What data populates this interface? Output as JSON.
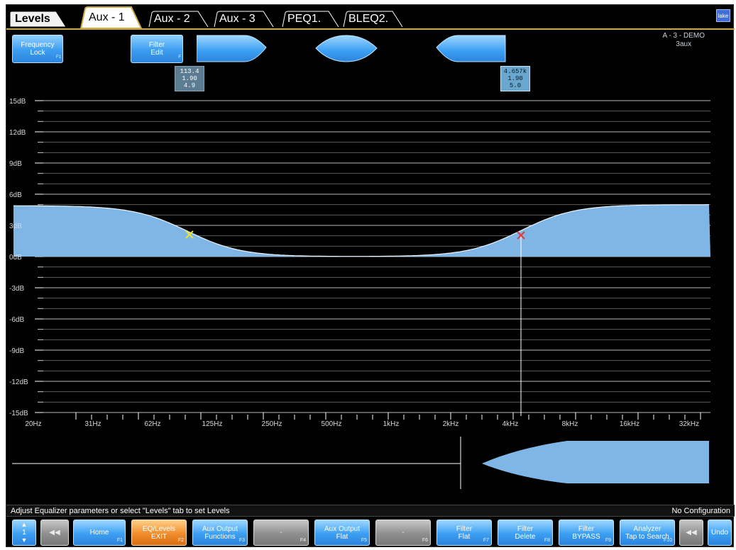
{
  "tabs": [
    {
      "label": "Levels"
    },
    {
      "label": "Aux - 1"
    },
    {
      "label": "Aux - 2"
    },
    {
      "label": "Aux - 3"
    },
    {
      "label": "PEQ1."
    },
    {
      "label": "BLEQ2."
    }
  ],
  "logo_text": "lake",
  "device": {
    "line1": "A - 3 - DEMO",
    "line2": "3aux"
  },
  "top_buttons": {
    "frequency_lock": {
      "line1": "Frequency",
      "line2": "Lock",
      "fkey": "F1"
    },
    "filter_edit": {
      "line1": "Filter",
      "line2": "Edit",
      "fkey": "F"
    }
  },
  "readout1": {
    "freq": "113.4",
    "q": "1.90",
    "gain": "4.9"
  },
  "readout2": {
    "freq": "4.657k",
    "q": "1.90",
    "gain": "5.0"
  },
  "y_axis": [
    "15dB",
    "12dB",
    "9dB",
    "6dB",
    "3dB",
    "0dB",
    "-3dB",
    "-6dB",
    "-9dB",
    "-12dB",
    "-15dB"
  ],
  "x_axis": [
    "20Hz",
    "31Hz",
    "62Hz",
    "125Hz",
    "250Hz",
    "500Hz",
    "1kHz",
    "2kHz",
    "4kHz",
    "8kHz",
    "16kHz",
    "32kHz"
  ],
  "status": {
    "left": "Adjust Equalizer parameters or select \"Levels\" tab to set Levels",
    "right": "No Configuration"
  },
  "toolbar": [
    {
      "line1": "1",
      "line2": "",
      "fkey": ""
    },
    {
      "line1": "",
      "line2": "",
      "fkey": ""
    },
    {
      "line1": "Home",
      "line2": "",
      "fkey": "F1"
    },
    {
      "line1": "EQ/Levels",
      "line2": "EXIT",
      "fkey": "F2"
    },
    {
      "line1": "Aux Output",
      "line2": "Functions",
      "fkey": "F3"
    },
    {
      "line1": "-",
      "line2": "",
      "fkey": "F4"
    },
    {
      "line1": "Aux Output",
      "line2": "Flat",
      "fkey": "F5"
    },
    {
      "line1": "-",
      "line2": "",
      "fkey": "F6"
    },
    {
      "line1": "Filter",
      "line2": "Flat",
      "fkey": "F7"
    },
    {
      "line1": "Filter",
      "line2": "Delete",
      "fkey": "F8"
    },
    {
      "line1": "Filter",
      "line2": "BYPASS",
      "fkey": "F9"
    },
    {
      "line1": "Analyzer",
      "line2": "Tap to Search",
      "fkey": "F10"
    },
    {
      "line1": "",
      "line2": "",
      "fkey": ""
    },
    {
      "line1": "Undo",
      "line2": "",
      "fkey": ""
    }
  ],
  "colors": {
    "accent": "#3c9df0",
    "fill": "#7fb6e6",
    "tab_rule": "#cda94a",
    "marker1": "#e8e23a",
    "marker2": "#e03a3a"
  }
}
